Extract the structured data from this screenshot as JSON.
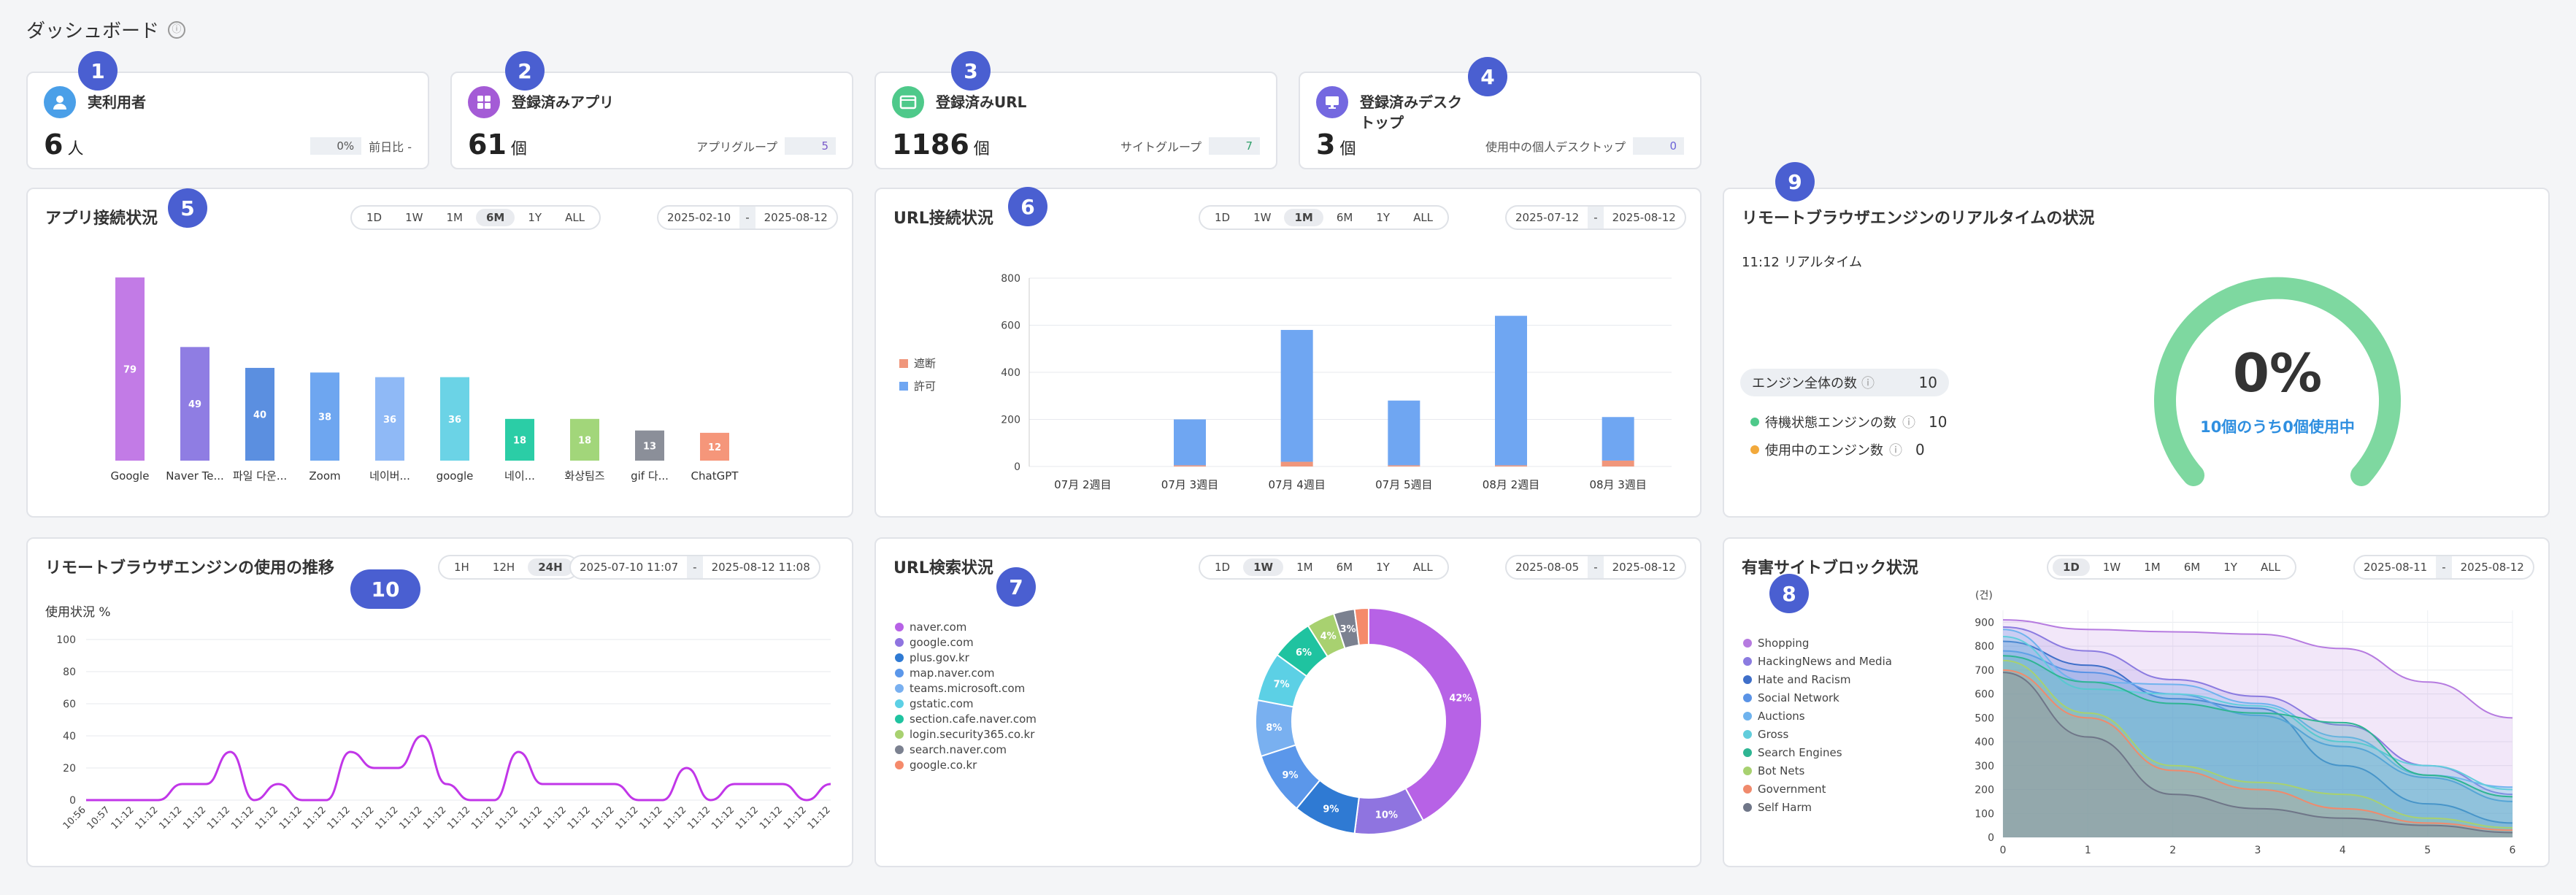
{
  "page": {
    "title": "ダッシュボード",
    "info_icon": "ⓘ"
  },
  "badges": [
    "1",
    "2",
    "3",
    "4",
    "5",
    "6",
    "7",
    "8",
    "9",
    "10"
  ],
  "kpis": [
    {
      "label": "実利用者",
      "value": "6",
      "unit": "人",
      "sub_box": "0%",
      "sub_label": "前日比 -",
      "icon": "user-icon",
      "color": "#4a9fe8"
    },
    {
      "label": "登録済みアプリ",
      "value": "61",
      "unit": "個",
      "sub_label": "アプリグループ",
      "sub_box": "5",
      "icon": "apps-icon",
      "color": "#a45bd6"
    },
    {
      "label": "登録済みURL",
      "value": "1186",
      "unit": "個",
      "sub_label": "サイトグループ",
      "sub_box": "7",
      "icon": "browser-icon",
      "color": "#4ec98a"
    },
    {
      "label": "登録済みデスク\nトップ",
      "value": "3",
      "unit": "個",
      "sub_label": "使用中の個人デスクトップ",
      "sub_box": "0",
      "icon": "desktop-icon",
      "color": "#7468e0"
    }
  ],
  "app_conn": {
    "title": "アプリ接続状況",
    "periods": [
      "1D",
      "1W",
      "1M",
      "6M",
      "1Y",
      "ALL"
    ],
    "active": "6M",
    "date_from": "2025-02-10",
    "date_to": "2025-08-12",
    "chart_data": {
      "type": "bar",
      "categories": [
        "Google",
        "Naver Te...",
        "파일 다운...",
        "Zoom",
        "네이버...",
        "google",
        "네이...",
        "화상팀즈",
        "gif 다...",
        "ChatGPT"
      ],
      "values": [
        79,
        49,
        40,
        38,
        36,
        36,
        18,
        18,
        13,
        12
      ],
      "colors": [
        "#c27be6",
        "#8f7de3",
        "#5b8fe0",
        "#6ea6f0",
        "#8fb9f6",
        "#6bd3e6",
        "#2bcda6",
        "#a2d67a",
        "#8b8f99",
        "#f5967a"
      ],
      "ylim": [
        0,
        85
      ]
    }
  },
  "url_conn": {
    "title": "URL接続状況",
    "periods": [
      "1D",
      "1W",
      "1M",
      "6M",
      "1Y",
      "ALL"
    ],
    "active": "1M",
    "date_from": "2025-07-12",
    "date_to": "2025-08-12",
    "chart_data": {
      "type": "bar",
      "categories": [
        "07月 2週目",
        "07月 3週目",
        "07月 4週目",
        "07月 5週目",
        "08月 2週目",
        "08月 3週目"
      ],
      "series": [
        {
          "name": "遮断",
          "color": "#f0967b",
          "values": [
            0,
            5,
            20,
            5,
            5,
            25
          ]
        },
        {
          "name": "許可",
          "color": "#6fa6f2",
          "values": [
            0,
            195,
            560,
            275,
            635,
            185
          ]
        }
      ],
      "yticks": [
        0,
        200,
        400,
        600,
        800
      ],
      "ylim": [
        0,
        800
      ]
    }
  },
  "realtime": {
    "title": "リモートブラウザエンジンのリアルタイムの状況",
    "time_label": "11:12 リアルタイム",
    "total_label": "エンジン全体の数",
    "total_value": "10",
    "idle_label": "待機状態エンジンの数",
    "idle_value": "10",
    "used_label": "使用中のエンジン数",
    "used_value": "0",
    "gauge_value": "0%",
    "gauge_caption": "10個のうち0個使用中",
    "gauge_fraction": 0
  },
  "usage": {
    "title": "リモートブラウザエンジンの使用の推移",
    "periods": [
      "1H",
      "12H",
      "24H"
    ],
    "active": "24H",
    "date_from": "2025-07-10 11:07",
    "date_to": "2025-08-12 11:08",
    "ylabel": "使用状況 %",
    "chart_data": {
      "type": "line",
      "x": [
        "10:56",
        "10:57",
        "11:12",
        "11:12",
        "11:12",
        "11:12",
        "11:12",
        "11:12",
        "11:12",
        "11:12",
        "11:12",
        "11:12",
        "11:12",
        "11:12",
        "11:12",
        "11:12",
        "11:12",
        "11:12",
        "11:12",
        "11:12",
        "11:12",
        "11:12",
        "11:12",
        "11:12",
        "11:12",
        "11:12",
        "11:12",
        "11:12",
        "11:12",
        "11:12",
        "11:12",
        "11:12"
      ],
      "values": [
        0,
        0,
        0,
        0,
        10,
        10,
        30,
        0,
        10,
        0,
        0,
        30,
        20,
        20,
        40,
        10,
        0,
        0,
        30,
        10,
        10,
        10,
        10,
        0,
        0,
        20,
        0,
        10,
        10,
        10,
        0,
        10
      ],
      "yticks": [
        0,
        20,
        40,
        60,
        80,
        100
      ],
      "ylim": [
        0,
        100
      ],
      "color": "#c136e8"
    }
  },
  "url_search": {
    "title": "URL検索状況",
    "periods": [
      "1D",
      "1W",
      "1M",
      "6M",
      "1Y",
      "ALL"
    ],
    "active": "1W",
    "date_from": "2025-08-05",
    "date_to": "2025-08-12",
    "chart_data": {
      "type": "pie",
      "categories": [
        "naver.com",
        "google.com",
        "plus.gov.kr",
        "map.naver.com",
        "teams.microsoft.com",
        "gstatic.com",
        "section.cafe.naver.com",
        "login.security365.co.kr",
        "search.naver.com",
        "google.co.kr"
      ],
      "values": [
        42,
        10,
        9,
        9,
        8,
        7,
        6,
        4,
        3,
        2
      ],
      "labels": [
        "42%",
        "10%",
        "9%",
        "9%",
        "8%",
        "7%",
        "6%",
        "4%",
        "3%",
        ""
      ],
      "colors": [
        "#b762e6",
        "#8f74e0",
        "#2f7ad3",
        "#5b97ea",
        "#79b0f0",
        "#5cd0e5",
        "#1fc3a0",
        "#a8d170",
        "#7b8190",
        "#f58a6b"
      ]
    }
  },
  "harmful": {
    "title": "有害サイトブロック状況",
    "periods": [
      "1D",
      "1W",
      "1M",
      "6M",
      "1Y",
      "ALL"
    ],
    "active": "1D",
    "date_from": "2025-08-11",
    "date_to": "2025-08-12",
    "yunit": "(건)",
    "chart_data": {
      "type": "area",
      "x": [
        0,
        1,
        2,
        3,
        4,
        5,
        6
      ],
      "yticks": [
        0,
        100,
        200,
        300,
        400,
        500,
        600,
        700,
        800,
        900
      ],
      "ylim": [
        0,
        950
      ],
      "series": [
        {
          "name": "Shopping",
          "color": "#b67be0",
          "values": [
            910,
            870,
            860,
            850,
            790,
            650,
            500
          ]
        },
        {
          "name": "HackingNews and Media",
          "color": "#8b7be0",
          "values": [
            880,
            780,
            660,
            590,
            470,
            300,
            180
          ]
        },
        {
          "name": "Hate and Racism",
          "color": "#3f6fc9",
          "values": [
            820,
            720,
            580,
            540,
            300,
            140,
            60
          ]
        },
        {
          "name": "Social Network",
          "color": "#5a93e6",
          "values": [
            780,
            690,
            600,
            510,
            380,
            250,
            150
          ]
        },
        {
          "name": "Auctions",
          "color": "#6fb3ee",
          "values": [
            870,
            650,
            640,
            560,
            420,
            260,
            210
          ]
        },
        {
          "name": "Gross",
          "color": "#62cddc",
          "values": [
            840,
            620,
            600,
            550,
            400,
            300,
            200
          ]
        },
        {
          "name": "Search Engines",
          "color": "#2fb593",
          "values": [
            760,
            650,
            560,
            520,
            480,
            260,
            170
          ]
        },
        {
          "name": "Bot Nets",
          "color": "#a8d170",
          "values": [
            740,
            520,
            300,
            230,
            180,
            80,
            40
          ]
        },
        {
          "name": "Government",
          "color": "#f08a6c",
          "values": [
            700,
            500,
            280,
            200,
            120,
            60,
            30
          ]
        },
        {
          "name": "Self Harm",
          "color": "#6f7688",
          "values": [
            690,
            420,
            180,
            120,
            80,
            50,
            20
          ]
        }
      ]
    }
  }
}
